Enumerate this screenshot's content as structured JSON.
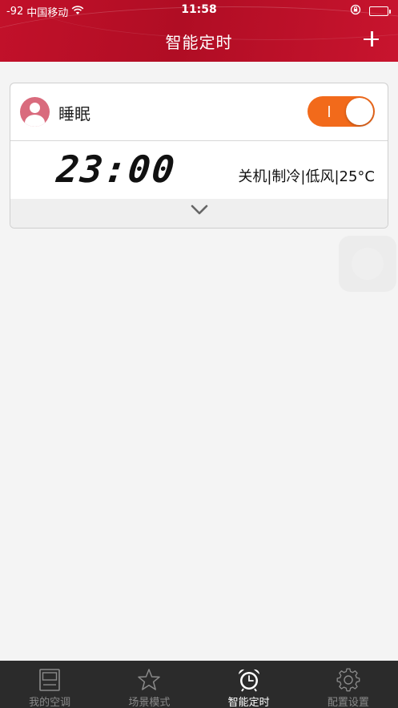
{
  "status_bar": {
    "signal": "-92",
    "carrier": "中国移动",
    "time": "11:58"
  },
  "header": {
    "title": "智能定时"
  },
  "timer_card": {
    "name": "睡眠",
    "enabled": true,
    "time": "23:00",
    "mode": "关机|制冷|低风|25°C"
  },
  "bottom_nav": {
    "items": [
      {
        "label": "我的空调",
        "icon": "remote-screen-icon",
        "active": false
      },
      {
        "label": "场景模式",
        "icon": "star-icon",
        "active": false
      },
      {
        "label": "智能定时",
        "icon": "alarm-clock-icon",
        "active": true
      },
      {
        "label": "配置设置",
        "icon": "gear-icon",
        "active": false
      }
    ]
  },
  "colors": {
    "header": "#c2112a",
    "toggle_on": "#f26a1b",
    "avatar": "#d96b7d",
    "nav_bg": "#2b2b2b"
  }
}
